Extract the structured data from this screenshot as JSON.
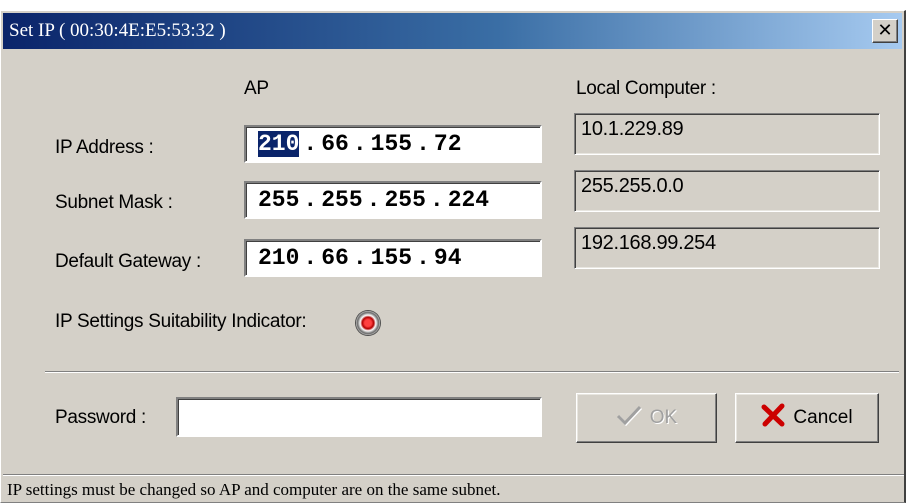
{
  "window": {
    "title": "Set IP ( 00:30:4E:E5:53:32 )",
    "close_label": "✕"
  },
  "headers": {
    "ap": "AP",
    "local": "Local Computer :"
  },
  "rows": {
    "ip": {
      "label": "IP Address :",
      "ap_octets": [
        "210",
        "66",
        "155",
        "72"
      ],
      "local": "10.1.229.89"
    },
    "mask": {
      "label": "Subnet Mask :",
      "ap_octets": [
        "255",
        "255",
        "255",
        "224"
      ],
      "local": "255.255.0.0"
    },
    "gateway": {
      "label": "Default Gateway :",
      "ap_octets": [
        "210",
        "66",
        "155",
        "94"
      ],
      "local": "192.168.99.254"
    }
  },
  "indicator": {
    "label": "IP Settings Suitability Indicator:",
    "status_color": "#e00000",
    "icon": "red-indicator-icon"
  },
  "password": {
    "label": "Password :",
    "value": ""
  },
  "buttons": {
    "ok": "OK",
    "ok_icon": "checkmark-icon",
    "ok_enabled": false,
    "cancel": "Cancel",
    "cancel_icon": "red-x-icon"
  },
  "status": "IP settings must be changed so AP and computer are on the same subnet.",
  "colors": {
    "titlebar_start": "#0a246a",
    "titlebar_end": "#a6caf0",
    "selection": "#0a246a",
    "dialog_bg": "#d4d0c8",
    "cancel_x": "#cc0000"
  }
}
